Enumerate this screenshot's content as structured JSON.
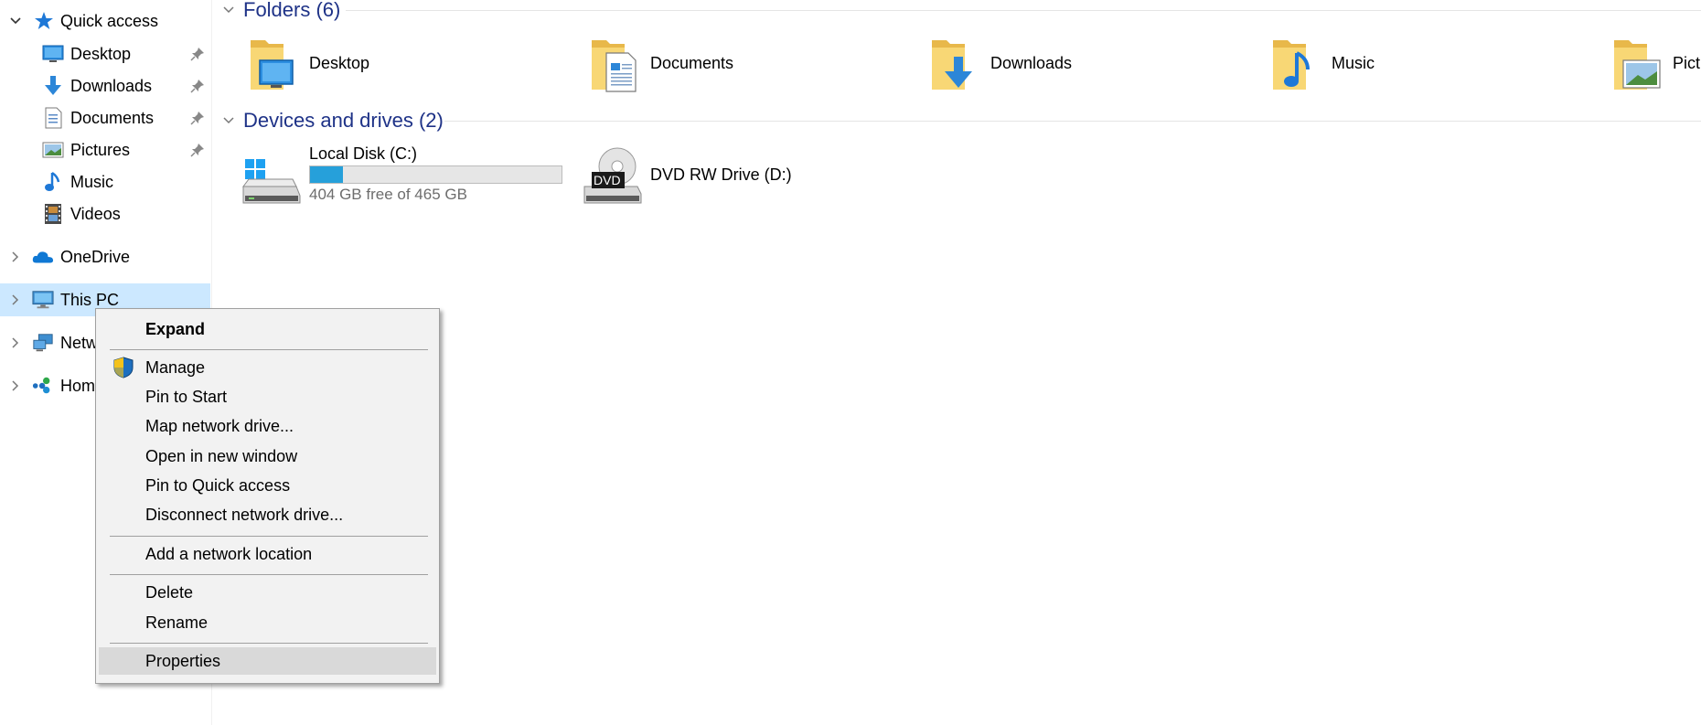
{
  "nav": {
    "quick_access": "Quick access",
    "items": [
      {
        "label": "Desktop",
        "pinned": true,
        "icon": "desktop-icon"
      },
      {
        "label": "Downloads",
        "pinned": true,
        "icon": "downloads-icon"
      },
      {
        "label": "Documents",
        "pinned": true,
        "icon": "documents-icon"
      },
      {
        "label": "Pictures",
        "pinned": true,
        "icon": "pictures-icon"
      },
      {
        "label": "Music",
        "pinned": false,
        "icon": "music-icon"
      },
      {
        "label": "Videos",
        "pinned": false,
        "icon": "videos-icon"
      }
    ],
    "onedrive": "OneDrive",
    "this_pc": "This PC",
    "network": "Netw",
    "homegroup": "Hom"
  },
  "folders": {
    "header": "Folders (6)",
    "items": [
      {
        "label": "Desktop",
        "icon": "desktop-folder-icon"
      },
      {
        "label": "Documents",
        "icon": "documents-folder-icon"
      },
      {
        "label": "Downloads",
        "icon": "downloads-folder-icon"
      },
      {
        "label": "Music",
        "icon": "music-folder-icon"
      },
      {
        "label": "Pict",
        "icon": "pictures-folder-icon"
      }
    ]
  },
  "drives": {
    "header": "Devices and drives (2)",
    "local_disk": {
      "label": "Local Disk (C:)",
      "free_text": "404 GB free of 465 GB",
      "used_fraction": 0.131
    },
    "dvd": {
      "label": "DVD RW Drive (D:)",
      "badge": "DVD"
    }
  },
  "context_menu": {
    "items": [
      {
        "label": "Expand",
        "bold": true
      },
      {
        "label": "Manage",
        "icon": "shield-icon"
      },
      {
        "label": "Pin to Start"
      },
      {
        "label": "Map network drive..."
      },
      {
        "label": "Open in new window"
      },
      {
        "label": "Pin to Quick access"
      },
      {
        "label": "Disconnect network drive..."
      },
      {
        "label": "Add a network location"
      },
      {
        "label": "Delete"
      },
      {
        "label": "Rename"
      },
      {
        "label": "Properties",
        "highlighted": true
      }
    ]
  },
  "colors": {
    "header_blue": "#1e3287",
    "selection": "#cce8ff",
    "progress": "#26a0da",
    "folder_yellow": "#f8d775"
  }
}
